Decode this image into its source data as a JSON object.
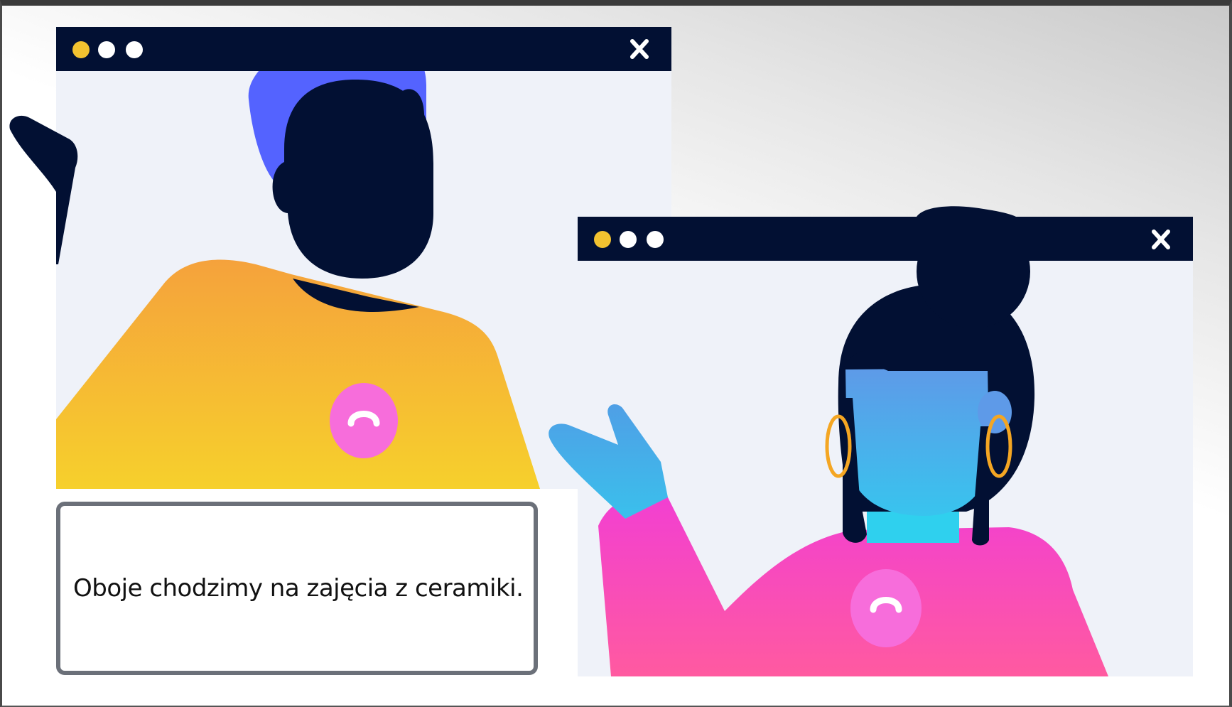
{
  "windows": [
    {
      "name": "video-call-window-left",
      "controls": [
        "minimize-dot",
        "maximize-dot",
        "restore-dot"
      ],
      "close_icon": "close-icon",
      "hangup_icon": "hang-up-phone-icon"
    },
    {
      "name": "video-call-window-right",
      "controls": [
        "minimize-dot",
        "maximize-dot",
        "restore-dot"
      ],
      "close_icon": "close-icon",
      "hangup_icon": "hang-up-phone-icon"
    }
  ],
  "colors": {
    "titlebar": "#021033",
    "window_bg": "#eff2f9",
    "dot_yellow": "#f2c230",
    "dot_white": "#ffffff",
    "man_hair": "#5463ff",
    "man_shirt_top": "#f5a23c",
    "man_shirt_bottom": "#f6d02c",
    "woman_face_top": "#5e9ae8",
    "woman_face_bottom": "#38c4ee",
    "woman_shirt_top": "#f23fd2",
    "woman_shirt_bottom": "#ff5aa0",
    "hangup_button": "#f76ddb",
    "earring": "#f4a623",
    "dark": "#021033"
  },
  "subtitle": {
    "text": "Oboje chodzimy na zajęcia z ceramiki."
  }
}
